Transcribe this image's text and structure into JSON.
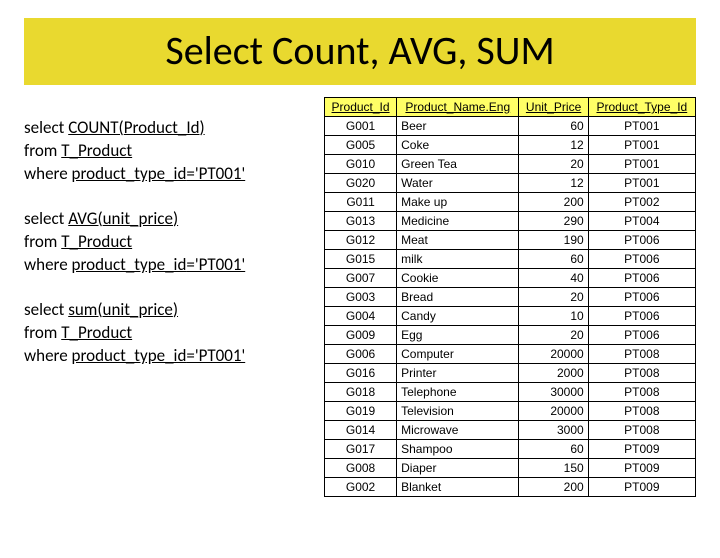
{
  "title": "Select Count, AVG, SUM",
  "queries": [
    {
      "l1a": "select ",
      "l1b": "COUNT(",
      "l1c": "Product_Id",
      "l1d": ")",
      "l2a": "from ",
      "l2b": "T_Product",
      "l3a": "where ",
      "l3b": "product_type_id",
      "l3c": "='PT001'"
    },
    {
      "l1a": "select ",
      "l1b": "AVG(",
      "l1c": "unit_price",
      "l1d": ")",
      "l2a": "from ",
      "l2b": "T_Product",
      "l3a": "where ",
      "l3b": "product_type_id",
      "l3c": "='PT001'"
    },
    {
      "l1a": "select ",
      "l1b": "sum(",
      "l1c": "unit_price",
      "l1d": ")",
      "l2a": "from ",
      "l2b": "T_Product",
      "l3a": "where ",
      "l3b": "product_type_id",
      "l3c": "='PT001'"
    }
  ],
  "table": {
    "headers": [
      "Product_Id",
      "Product_Name.Eng",
      "Unit_Price",
      "Product_Type_Id"
    ],
    "rows": [
      [
        "G001",
        "Beer",
        "60",
        "PT001"
      ],
      [
        "G005",
        "Coke",
        "12",
        "PT001"
      ],
      [
        "G010",
        "Green Tea",
        "20",
        "PT001"
      ],
      [
        "G020",
        "Water",
        "12",
        "PT001"
      ],
      [
        "G011",
        "Make up",
        "200",
        "PT002"
      ],
      [
        "G013",
        "Medicine",
        "290",
        "PT004"
      ],
      [
        "G012",
        "Meat",
        "190",
        "PT006"
      ],
      [
        "G015",
        "milk",
        "60",
        "PT006"
      ],
      [
        "G007",
        "Cookie",
        "40",
        "PT006"
      ],
      [
        "G003",
        "Bread",
        "20",
        "PT006"
      ],
      [
        "G004",
        "Candy",
        "10",
        "PT006"
      ],
      [
        "G009",
        "Egg",
        "20",
        "PT006"
      ],
      [
        "G006",
        "Computer",
        "20000",
        "PT008"
      ],
      [
        "G016",
        "Printer",
        "2000",
        "PT008"
      ],
      [
        "G018",
        "Telephone",
        "30000",
        "PT008"
      ],
      [
        "G019",
        "Television",
        "20000",
        "PT008"
      ],
      [
        "G014",
        "Microwave",
        "3000",
        "PT008"
      ],
      [
        "G017",
        "Shampoo",
        "60",
        "PT009"
      ],
      [
        "G008",
        "Diaper",
        "150",
        "PT009"
      ],
      [
        "G002",
        "Blanket",
        "200",
        "PT009"
      ]
    ]
  }
}
